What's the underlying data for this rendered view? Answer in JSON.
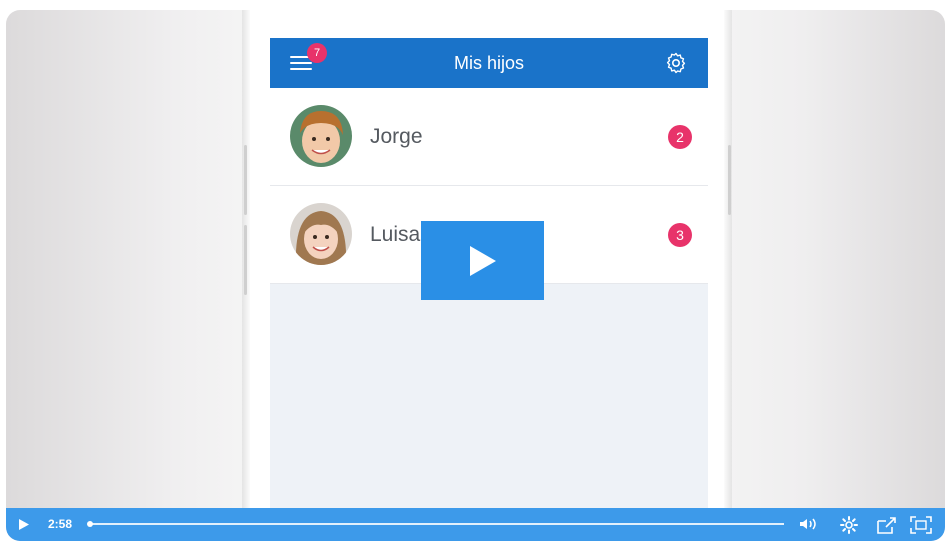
{
  "app": {
    "title": "Mis hijos",
    "menu_badge": "7"
  },
  "children": [
    {
      "name": "Jorge",
      "count": "2"
    },
    {
      "name": "Luisa",
      "count": "3"
    }
  ],
  "player": {
    "time": "2:58",
    "progress": 0.0
  },
  "colors": {
    "appbar": "#1a73c9",
    "badge": "#e8336a",
    "player_bar": "#3d9aea",
    "play_button": "#2a8fe6"
  },
  "icons": [
    "menu-icon",
    "gear-icon",
    "play-icon",
    "volume-icon",
    "settings-icon",
    "share-icon",
    "fullscreen-icon"
  ]
}
